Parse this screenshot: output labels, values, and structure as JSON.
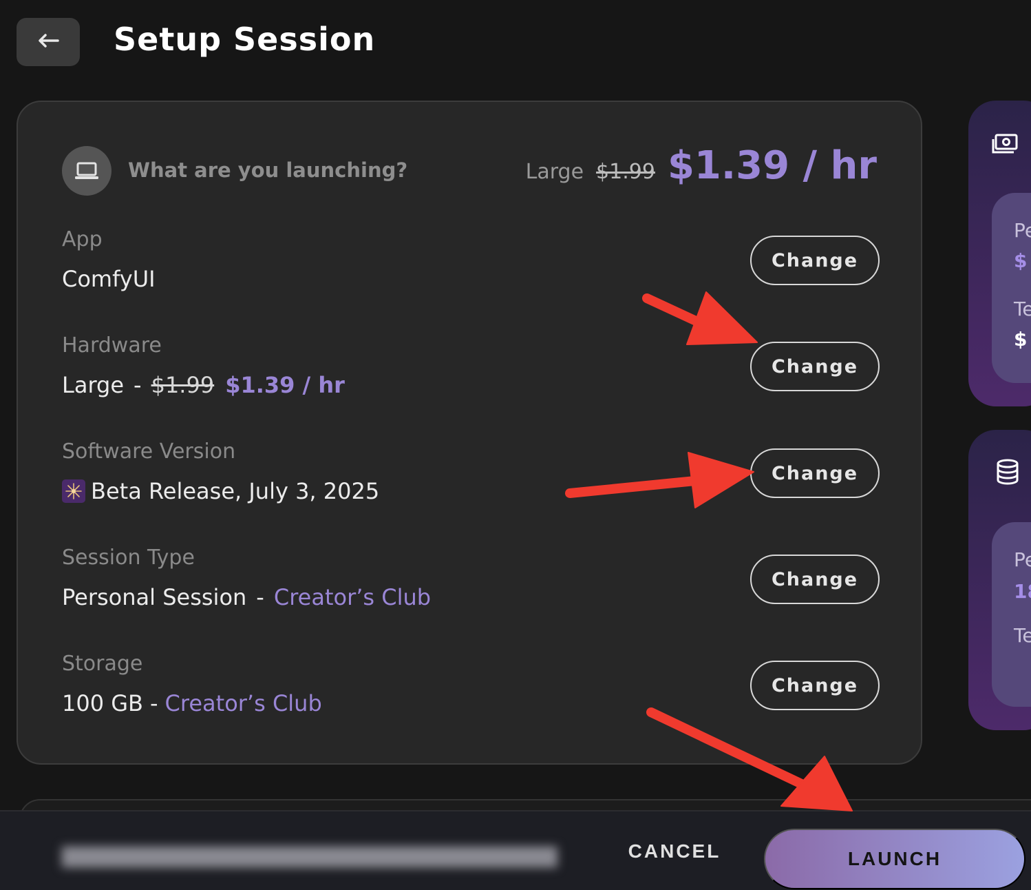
{
  "header": {
    "title": "Setup Session",
    "back_icon": "arrow-left-icon"
  },
  "card": {
    "question": "What are you launching?",
    "summary": {
      "tier": "Large",
      "old_price": "$1.99",
      "new_price": "$1.39 / hr"
    },
    "sections": {
      "app": {
        "label": "App",
        "value": "ComfyUI",
        "change_label": "Change"
      },
      "hardware": {
        "label": "Hardware",
        "tier": "Large",
        "separator": "-",
        "old_price": "$1.99",
        "new_price": "$1.39 / hr",
        "change_label": "Change"
      },
      "software": {
        "label": "Software Version",
        "icon": "sparkler-emoji",
        "value": "Beta Release, July 3, 2025",
        "change_label": "Change"
      },
      "session": {
        "label": "Session Type",
        "value": "Personal Session",
        "separator": "-",
        "plan": "Creator’s Club",
        "change_label": "Change"
      },
      "storage": {
        "label": "Storage",
        "value": "100 GB",
        "separator": "-",
        "plan": "Creator’s Club",
        "change_label": "Change"
      }
    }
  },
  "side_panels": {
    "pricing": {
      "icon": "money-icon",
      "line1": "Pe",
      "line2": "$",
      "line3": "Te",
      "line4": "$"
    },
    "storage": {
      "icon": "database-icon",
      "line1": "Pe",
      "line2": "18",
      "line3": "Te"
    }
  },
  "footer": {
    "cancel_label": "CANCEL",
    "launch_label": "LAUNCH"
  },
  "colors": {
    "accent": "#9a86d6",
    "annotation_arrow": "#f03a2e"
  }
}
